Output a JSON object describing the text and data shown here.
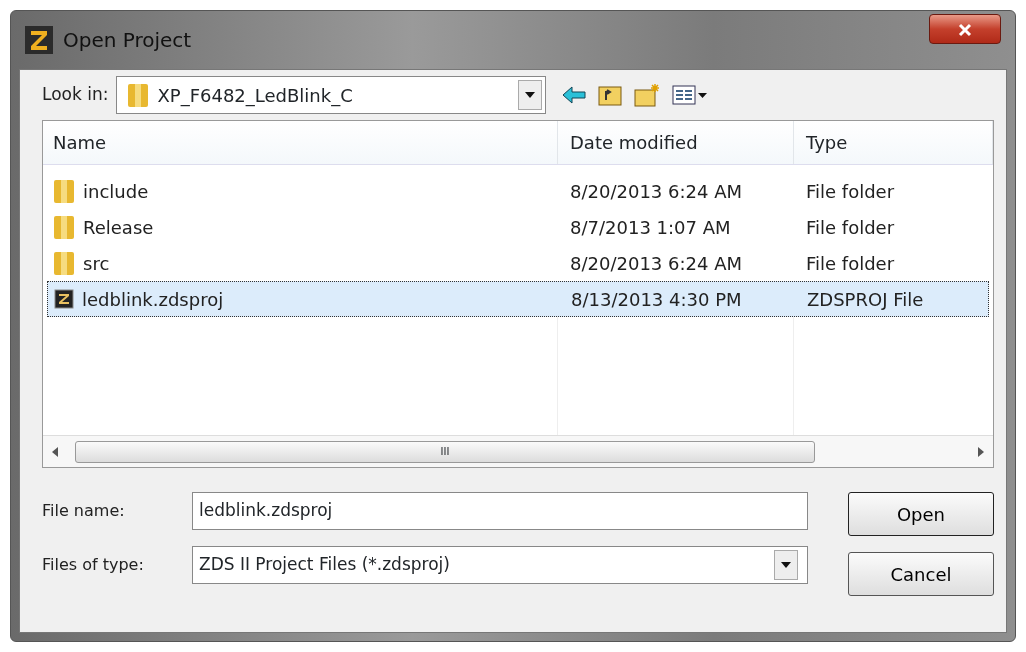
{
  "window": {
    "title": "Open Project"
  },
  "look_in": {
    "label": "Look in:",
    "value": "XP_F6482_LedBlink_C"
  },
  "columns": [
    "Name",
    "Date modified",
    "Type"
  ],
  "rows": [
    {
      "kind": "folder",
      "name": "include",
      "date": "8/20/2013 6:24 AM",
      "type": "File folder",
      "selected": false
    },
    {
      "kind": "folder",
      "name": "Release",
      "date": "8/7/2013 1:07 AM",
      "type": "File folder",
      "selected": false
    },
    {
      "kind": "folder",
      "name": "src",
      "date": "8/20/2013 6:24 AM",
      "type": "File folder",
      "selected": false
    },
    {
      "kind": "project",
      "name": "ledblink.zdsproj",
      "date": "8/13/2013 4:30 PM",
      "type": "ZDSPROJ File",
      "selected": true
    }
  ],
  "scroll_thumb": "III",
  "file_name": {
    "label": "File name:",
    "value": "ledblink.zdsproj"
  },
  "file_type": {
    "label": "Files of type:",
    "value": "ZDS II Project Files (*.zdsproj)"
  },
  "buttons": [
    "Open",
    "Cancel"
  ]
}
